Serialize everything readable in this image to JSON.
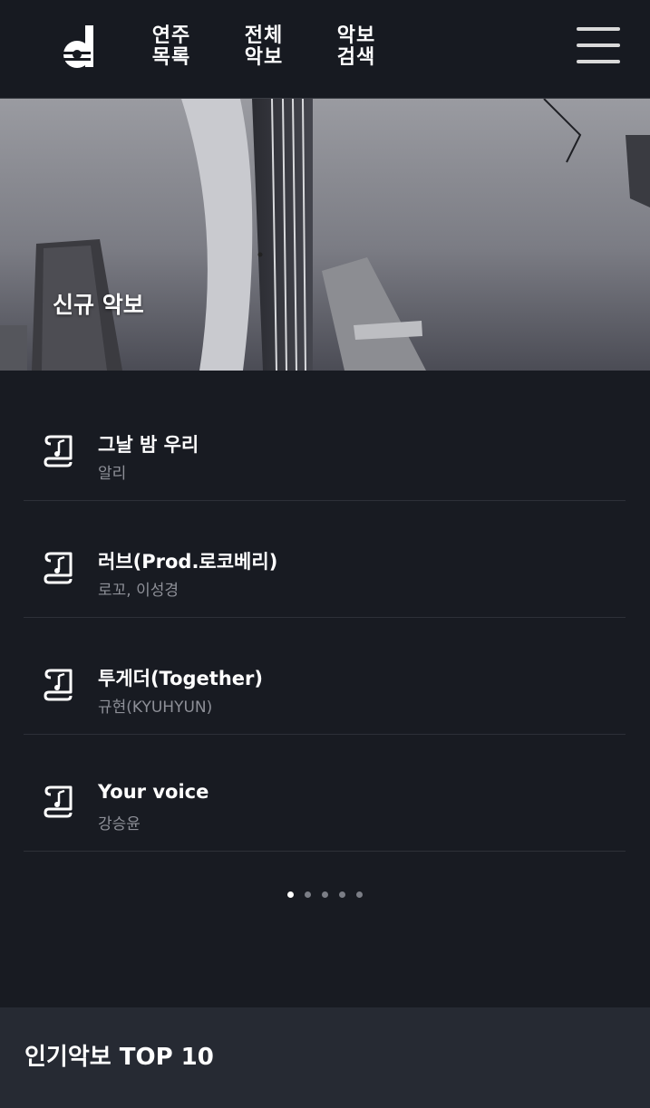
{
  "header": {
    "nav": [
      {
        "line1": "연주",
        "line2": "목록"
      },
      {
        "line1": "전체",
        "line2": "악보"
      },
      {
        "line1": "악보",
        "line2": "검색"
      }
    ]
  },
  "hero": {
    "title": "신규 악보"
  },
  "new_sheets": [
    {
      "title": "그날 밤 우리",
      "artist": "알리"
    },
    {
      "title": "러브(Prod.로코베리)",
      "artist": "로꼬, 이성경"
    },
    {
      "title": "투게더(Together)",
      "artist": "규현(KYUHYUN)"
    },
    {
      "title": "Your voice",
      "artist": "강승윤"
    }
  ],
  "pagination": {
    "total": 5,
    "active_index": 0
  },
  "popular": {
    "title": "인기악보 TOP 10"
  },
  "colors": {
    "background": "#181b22",
    "header": "#171a21",
    "section": "#262a33",
    "muted_text": "#8e9098"
  }
}
